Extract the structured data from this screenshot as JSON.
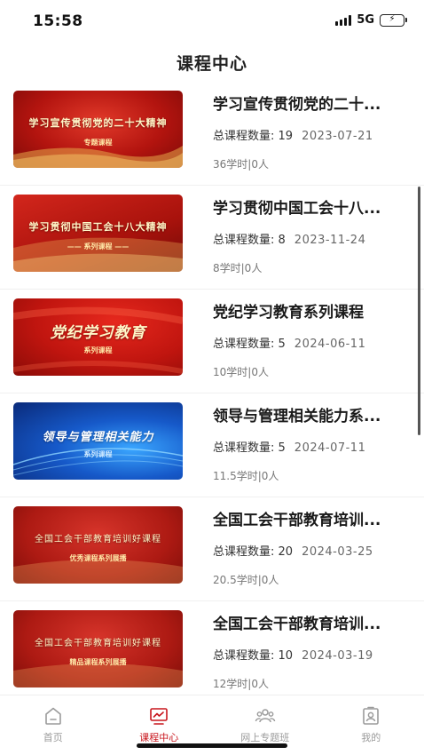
{
  "status_bar": {
    "time": "15:58",
    "network": "5G"
  },
  "header": {
    "title": "课程中心"
  },
  "courses": [
    {
      "title": "学习宣传贯彻党的二十...",
      "count_label": "总课程数量: 19",
      "date": "2023-07-21",
      "hours": "36学时|0人",
      "thumb_main": "学习宣传贯彻党的二十大精神",
      "thumb_sub": "专题课程"
    },
    {
      "title": "学习贯彻中国工会十八...",
      "count_label": "总课程数量: 8",
      "date": "2023-11-24",
      "hours": "8学时|0人",
      "thumb_main": "学习贯彻中国工会十八大精神",
      "thumb_sub": "—— 系列课程 ——"
    },
    {
      "title": "党纪学习教育系列课程",
      "count_label": "总课程数量: 5",
      "date": "2024-06-11",
      "hours": "10学时|0人",
      "thumb_main": "党纪学习教育",
      "thumb_sub": "系列课程"
    },
    {
      "title": "领导与管理相关能力系...",
      "count_label": "总课程数量: 5",
      "date": "2024-07-11",
      "hours": "11.5学时|0人",
      "thumb_main": "领导与管理相关能力",
      "thumb_sub": "系列课程"
    },
    {
      "title": "全国工会干部教育培训...",
      "count_label": "总课程数量: 20",
      "date": "2024-03-25",
      "hours": "20.5学时|0人",
      "thumb_main": "全国工会干部教育培训好课程",
      "thumb_sub": "优秀课程系列展播"
    },
    {
      "title": "全国工会干部教育培训...",
      "count_label": "总课程数量: 10",
      "date": "2024-03-19",
      "hours": "12学时|0人",
      "thumb_main": "全国工会干部教育培训好课程",
      "thumb_sub": "精品课程系列展播"
    }
  ],
  "tabs": [
    {
      "label": "首页",
      "icon": "home-icon",
      "active": false
    },
    {
      "label": "课程中心",
      "icon": "course-center-icon",
      "active": true
    },
    {
      "label": "网上专题班",
      "icon": "group-class-icon",
      "active": false
    },
    {
      "label": "我的",
      "icon": "profile-icon",
      "active": false
    }
  ],
  "colors": {
    "accent": "#c8161d",
    "inactive": "#9b9b9b",
    "battery": "#35c759"
  }
}
